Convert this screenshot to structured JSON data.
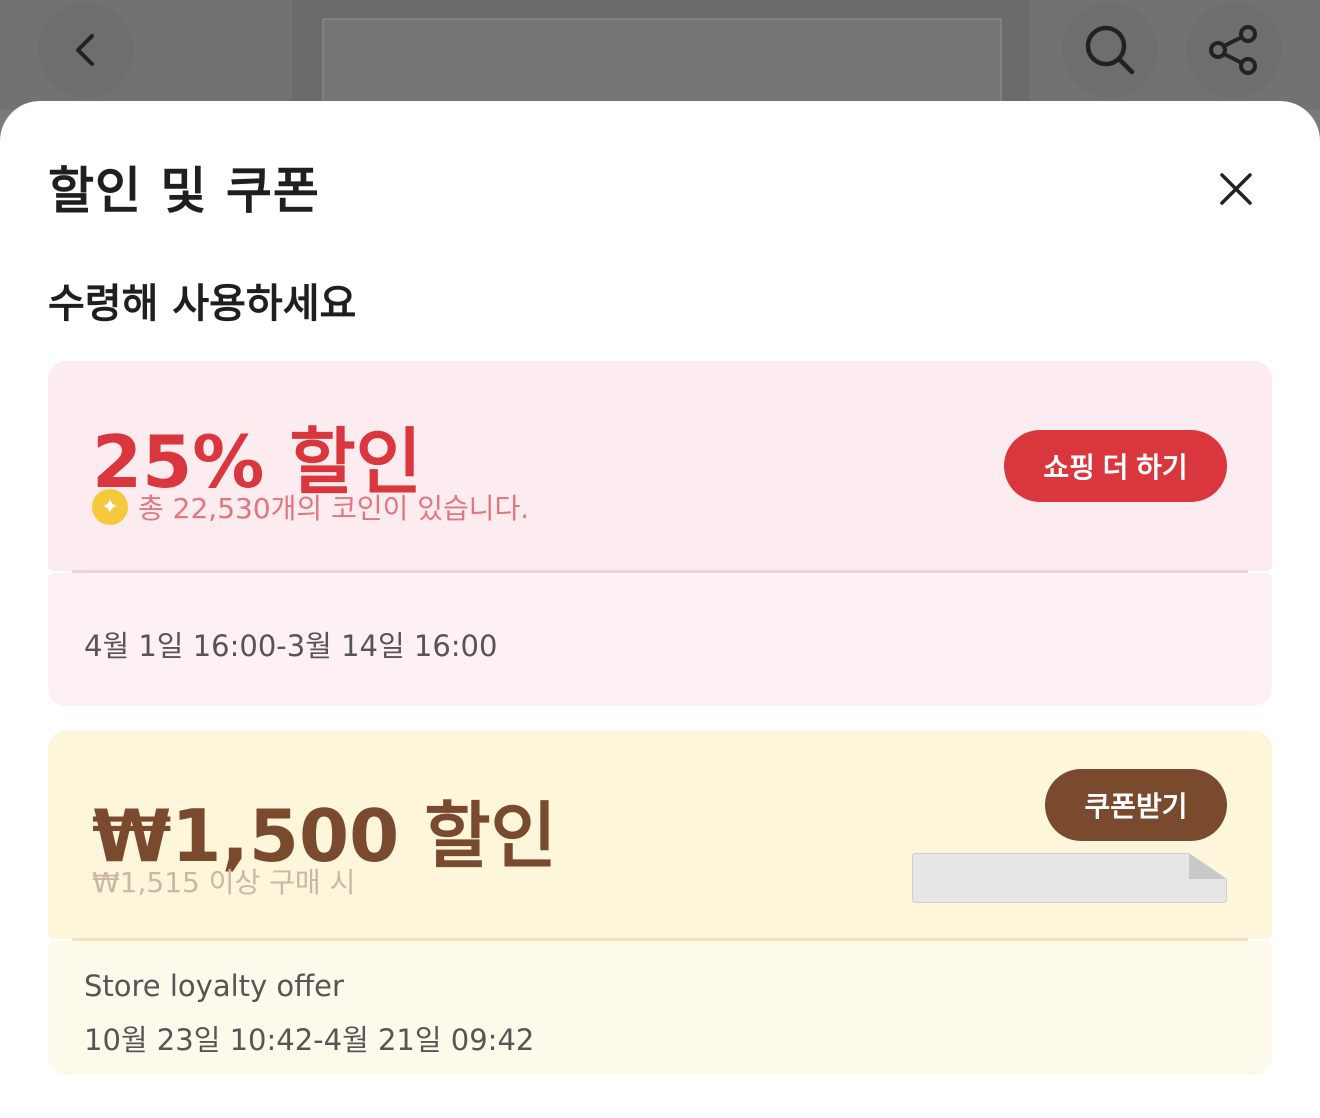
{
  "sheet": {
    "title": "할인 및 쿠폰",
    "section_title": "수령해 사용하세요"
  },
  "coupons": [
    {
      "amount": "25% 할인",
      "coin_text": "총 22,530개의 코인이 있습니다.",
      "button_label": "쇼핑 더 하기",
      "date_range": "4월 1일 16:00-3월 14일 16:00",
      "accent_color": "#d9363e"
    },
    {
      "amount": "₩1,500 할인",
      "min_purchase": "₩1,515 이상 구매 시",
      "button_label": "쿠폰받기",
      "offer_name": "Store loyalty offer",
      "date_range": "10월 23일 10:42-4월 21일 09:42",
      "accent_color": "#7a4a2e"
    }
  ],
  "icons": {
    "back": "chevron-left-icon",
    "search": "search-icon",
    "share": "share-icon",
    "close": "close-icon",
    "coin": "coin-icon"
  }
}
